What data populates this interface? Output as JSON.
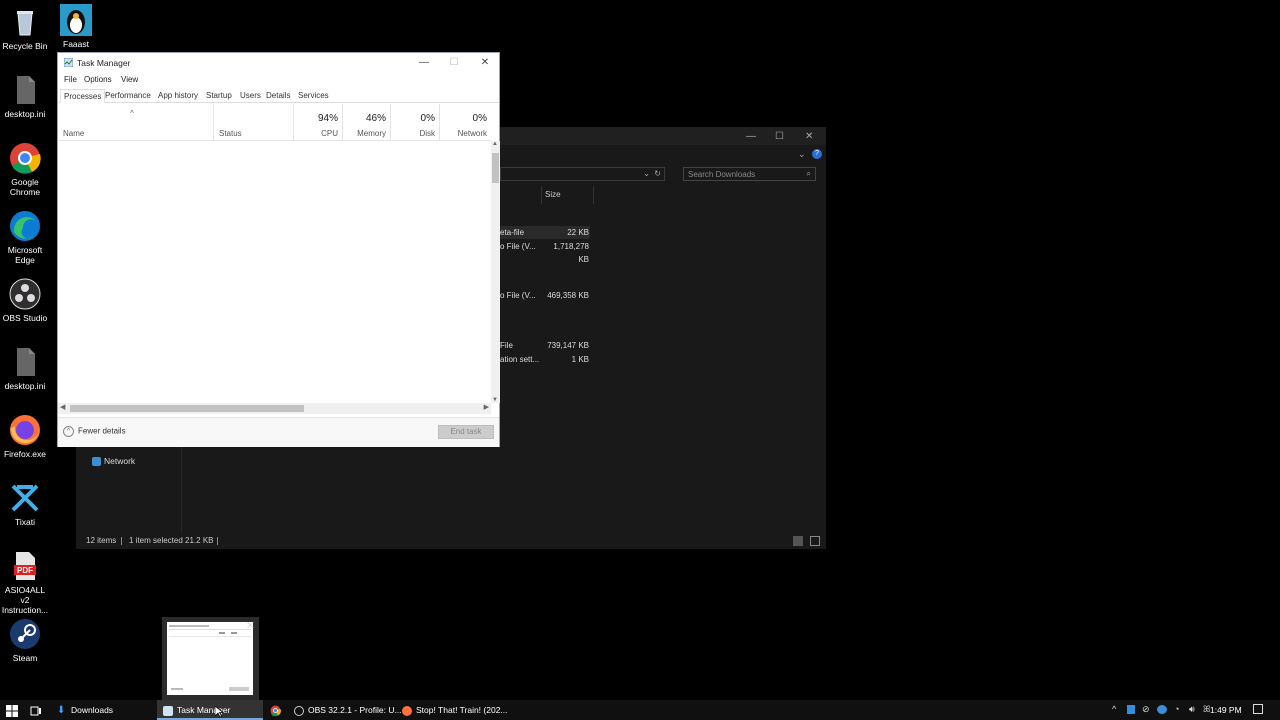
{
  "desktop_icons": [
    {
      "label": "Recycle Bin",
      "icon": "recycle-bin-icon"
    },
    {
      "label": "Faaast",
      "icon": "penguin-app-icon"
    },
    {
      "label": "desktop.ini",
      "icon": "file-icon"
    },
    {
      "label": "Google Chrome",
      "icon": "chrome-icon"
    },
    {
      "label": "Microsoft Edge",
      "icon": "edge-icon"
    },
    {
      "label": "OBS Studio",
      "icon": "obs-icon"
    },
    {
      "label": "desktop.ini",
      "icon": "file-icon"
    },
    {
      "label": "Firefox.exe",
      "icon": "firefox-icon"
    },
    {
      "label": "Tixati",
      "icon": "tixati-icon"
    },
    {
      "label": "ASIO4ALL v2 Instruction...",
      "icon": "pdf-icon"
    },
    {
      "label": "Steam",
      "icon": "steam-icon"
    }
  ],
  "explorer": {
    "search_placeholder": "Search Downloads",
    "size_header": "Size",
    "files": [
      {
        "type": "eta-file",
        "size": "22 KB"
      },
      {
        "type": "o File (V...",
        "size": "1,718,278 KB"
      },
      {
        "type": "o File (V...",
        "size": "469,358 KB"
      },
      {
        "type": "File",
        "size": "739,147 KB"
      },
      {
        "type": "ation sett...",
        "size": "1 KB"
      }
    ],
    "nav_network": "Network",
    "status_items": "12 items",
    "status_selected": "1 item selected  21.2 KB"
  },
  "task_manager": {
    "title": "Task Manager",
    "menu": [
      "File",
      "Options",
      "View"
    ],
    "tabs": [
      "Processes",
      "Performance",
      "App history",
      "Startup",
      "Users",
      "Details",
      "Services"
    ],
    "columns": {
      "name": "Name",
      "status": "Status",
      "cpu_pct": "94%",
      "cpu": "CPU",
      "memory_pct": "46%",
      "memory": "Memory",
      "disk_pct": "0%",
      "disk": "Disk",
      "network_pct": "0%",
      "network": "Network"
    },
    "fewer_details": "Fewer details",
    "end_task": "End task"
  },
  "taskbar": {
    "items": [
      "Downloads",
      "Task Manager",
      "",
      "OBS 32.2.1 - Profile: U...",
      "Stop! That! Train! (202..."
    ],
    "time": "1:49 PM"
  },
  "colors": {
    "accent": "#7aa7d8",
    "explorer_bg": "#191919",
    "taskbar_bg": "#101010"
  }
}
